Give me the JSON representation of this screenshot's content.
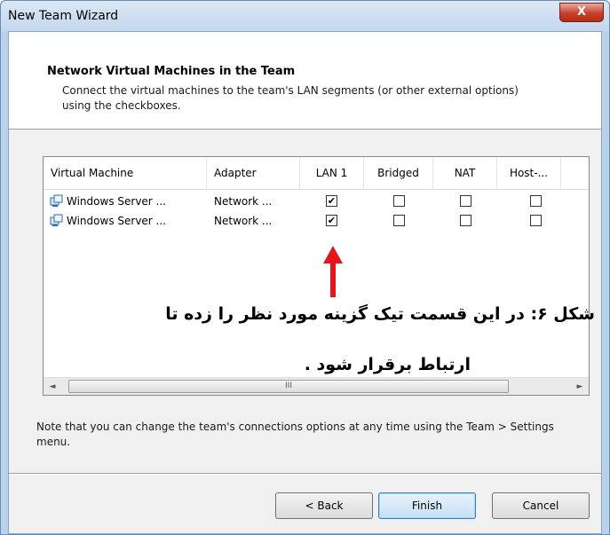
{
  "window": {
    "title": "New Team Wizard",
    "close_symbol": "X"
  },
  "header": {
    "title": "Network Virtual Machines in the Team",
    "description": "Connect the virtual machines to the team's LAN segments (or other external options) using the checkboxes."
  },
  "table": {
    "columns": [
      "Virtual Machine",
      "Adapter",
      "LAN 1",
      "Bridged",
      "NAT",
      "Host-..."
    ],
    "rows": [
      {
        "vm": "Windows Server ...",
        "adapter": "Network ...",
        "lan1": true,
        "bridged": false,
        "nat": false,
        "host": false
      },
      {
        "vm": "Windows Server ...",
        "adapter": "Network ...",
        "lan1": true,
        "bridged": false,
        "nat": false,
        "host": false
      }
    ],
    "scroll_left": "◄",
    "scroll_right": "►",
    "scroll_grip": "III"
  },
  "annotation": {
    "line1": "شکل ۶: در این قسمت تیک گزینه مورد نظر را زده تا",
    "line2": "ارتباط برقرار شود ."
  },
  "note": "Note that you can change the team's connections options at any time using the Team > Settings menu.",
  "buttons": {
    "back": "< Back",
    "finish": "Finish",
    "cancel": "Cancel"
  },
  "colors": {
    "arrow": "#e8141b",
    "titlebar": "#c3d7ee",
    "close": "#c7402a"
  },
  "icons": {
    "vm": "vm-network-icon",
    "arrow": "red-arrow-icon"
  }
}
